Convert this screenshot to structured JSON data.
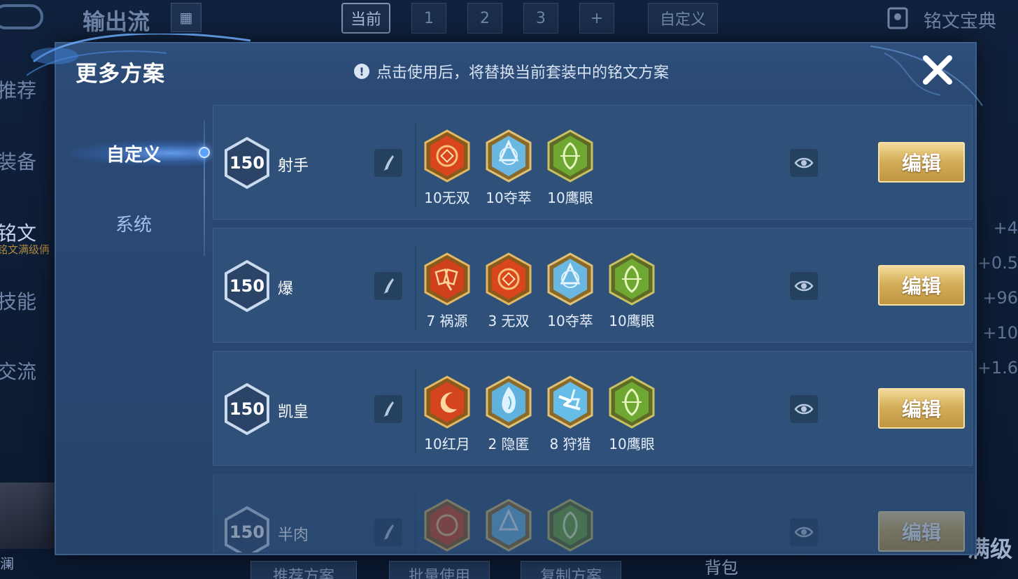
{
  "background": {
    "top_title": "输出流",
    "tabs": [
      "当前",
      "1",
      "2",
      "3",
      "+"
    ],
    "custom_tab": "自定义",
    "codex_label": "铭文宝典",
    "left_nav": [
      "推荐",
      "装备",
      "铭文",
      "技能",
      "交流"
    ],
    "left_sub": "铭文满级侢",
    "right_values": [
      "+4",
      "+0.5",
      "+96",
      "+10",
      "+1.6"
    ],
    "bottom_buttons": [
      "推荐方案",
      "批量使用",
      "复制方案"
    ],
    "bag_label": "背包",
    "hero_name": "澜",
    "full_level_label": "满级"
  },
  "dialog": {
    "title": "更多方案",
    "notice": "点击使用后，将替换当前套装中的铭文方案",
    "tabs": [
      {
        "label": "自定义",
        "active": true
      },
      {
        "label": "系统",
        "active": false
      }
    ],
    "edit_label": "编辑",
    "schemes": [
      {
        "level": "150",
        "name": "射手",
        "runes": [
          {
            "icon": "rune-wushuang-icon",
            "label": "10无双",
            "color": "#d94a1f"
          },
          {
            "icon": "rune-duocui-icon",
            "label": "10夺萃",
            "color": "#67b6e0"
          },
          {
            "icon": "rune-yingyan-icon",
            "label": "10鹰眼",
            "color": "#6fa832"
          }
        ]
      },
      {
        "level": "150",
        "name": "爆",
        "runes": [
          {
            "icon": "rune-huoyuan-icon",
            "label": "7 祸源",
            "color": "#d94a1f"
          },
          {
            "icon": "rune-wushuang-icon",
            "label": "3 无双",
            "color": "#d94a1f"
          },
          {
            "icon": "rune-duocui-icon",
            "label": "10夺萃",
            "color": "#67b6e0"
          },
          {
            "icon": "rune-yingyan-icon",
            "label": "10鹰眼",
            "color": "#6fa832"
          }
        ]
      },
      {
        "level": "150",
        "name": "凯皇",
        "runes": [
          {
            "icon": "rune-hongyue-icon",
            "label": "10红月",
            "color": "#d94a1f"
          },
          {
            "icon": "rune-yinni-icon",
            "label": "2 隐匿",
            "color": "#67b6e0"
          },
          {
            "icon": "rune-shoulie-icon",
            "label": "8 狩猎",
            "color": "#67b6e0"
          },
          {
            "icon": "rune-yingyan-icon",
            "label": "10鹰眼",
            "color": "#6fa832"
          }
        ]
      },
      {
        "level": "150",
        "name": "半肉",
        "runes": [
          {
            "icon": "rune-wushuang-icon",
            "label": "",
            "color": "#d94a1f"
          },
          {
            "icon": "rune-duocui-icon",
            "label": "",
            "color": "#67b6e0"
          },
          {
            "icon": "rune-yingyan-icon",
            "label": "",
            "color": "#6fa832"
          }
        ]
      }
    ]
  },
  "colors": {
    "dialog_bg": "#2b4a75",
    "row_bg": "#2f5179",
    "edit_gold": "#d6af5a",
    "active_glow": "#5da2ff"
  }
}
